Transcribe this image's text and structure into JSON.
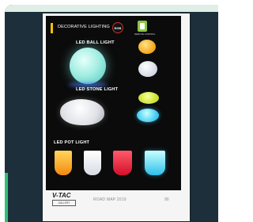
{
  "catalog": {
    "header_label": "DECORATIVE LIGHTING",
    "rgb_badge": "RGB",
    "remote_badge_label": "REMOTE CONTROL",
    "sections": {
      "ball": "LED BALL LIGHT",
      "stone": "LED STONE LIGHT",
      "pot": "LED POT LIGHT"
    },
    "footer": {
      "logo": "V-TAC",
      "gallery": "GALLERY",
      "roadmap": "ROAD MAP 2019",
      "page": "90"
    }
  }
}
